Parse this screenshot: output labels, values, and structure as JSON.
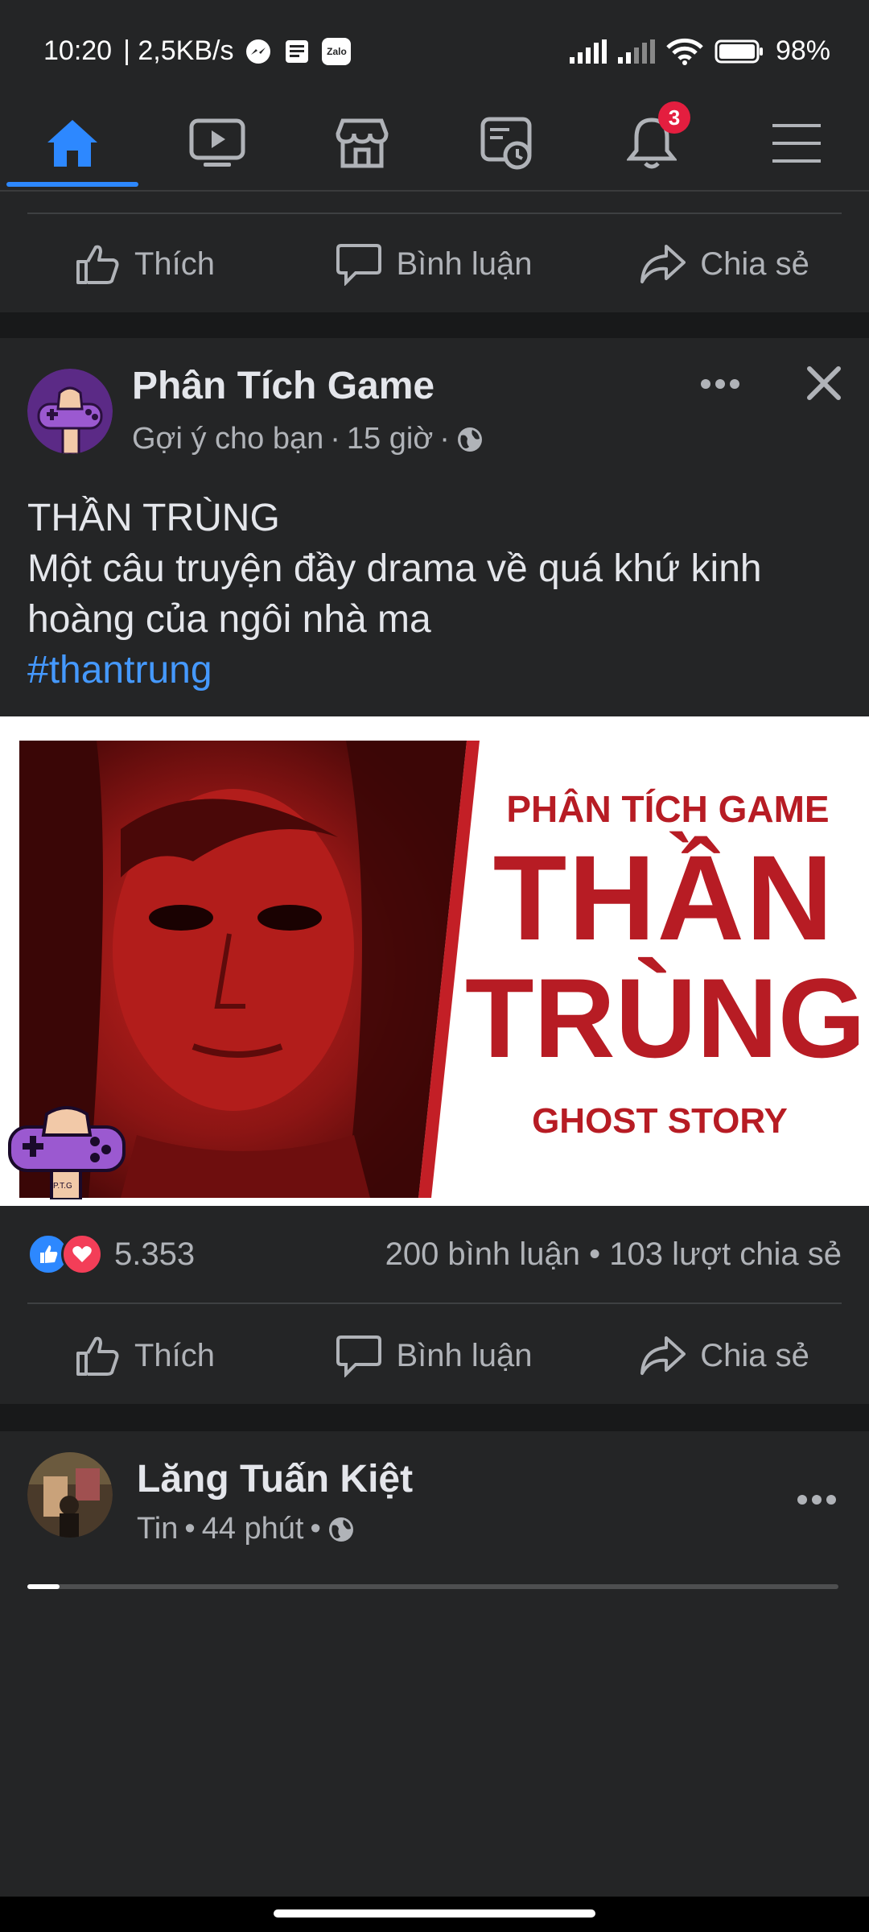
{
  "status": {
    "time": "10:20",
    "speed": "| 2,5KB/s",
    "zalo": "Zalo",
    "battery": "98%"
  },
  "nav": {
    "items": [
      "home-icon",
      "watch-icon",
      "marketplace-icon",
      "memories-icon",
      "notifications-icon",
      "menu-icon"
    ],
    "notification_count": "3",
    "active": "home"
  },
  "actions": {
    "like": "Thích",
    "comment": "Bình luận",
    "share": "Chia sẻ"
  },
  "post": {
    "page_name": "Phân Tích Game",
    "suggested": "Gợi ý cho bạn",
    "time": "15 giờ",
    "title": "THẦN TRÙNG",
    "body": "Một câu truyện đầy drama về quá khứ kinh hoàng của ngôi nhà ma",
    "hashtag": "#thantrung",
    "image_text": {
      "brand": "PHÂN TÍCH GAME",
      "line1": "THẦN",
      "line2": "TRÙNG",
      "subtitle": "GHOST STORY",
      "logo": "P.T.G"
    },
    "reactions_count": "5.353",
    "comments": "200 bình luận",
    "shares": "103 lượt chia sẻ"
  },
  "next_post": {
    "name": "Lăng Tuấn Kiệt",
    "type": "Tin",
    "time": "44 phút"
  },
  "story_progress": 0.04,
  "colors": {
    "background": "#242526",
    "separator": "#18191a",
    "accent": "#2d88ff",
    "text_secondary": "#b0b3b8",
    "poster_red": "#b71c24"
  }
}
